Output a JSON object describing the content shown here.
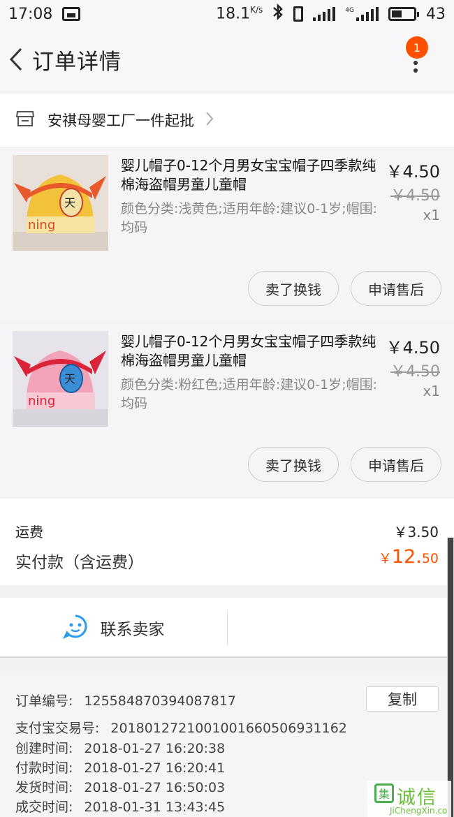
{
  "status_bar": {
    "time": "17:08",
    "speed": "18.1",
    "speed_unit": "K/s",
    "net_type": "4G",
    "battery": "43"
  },
  "nav": {
    "title": "订单详情",
    "badge_count": "1"
  },
  "shop": {
    "name": "安祺母婴工厂一件起批"
  },
  "items": [
    {
      "title": "婴儿帽子0-12个月男女宝宝帽子四季款纯棉海盗帽男童儿童帽",
      "sku": "颜色分类:浅黄色;适用年龄:建议0-1岁;帽围:均码",
      "price": "￥4.50",
      "original_price": "￥4.50",
      "quantity": "x1",
      "image_color": "yellow",
      "image_text": "ning",
      "sell_label": "卖了换钱",
      "after_sale_label": "申请售后"
    },
    {
      "title": "婴儿帽子0-12个月男女宝宝帽子四季款纯棉海盗帽男童儿童帽",
      "sku": "颜色分类:粉红色;适用年龄:建议0-1岁;帽围:均码",
      "price": "￥4.50",
      "original_price": "￥4.50",
      "quantity": "x1",
      "image_color": "pink",
      "image_text": "ning",
      "sell_label": "卖了换钱",
      "after_sale_label": "申请售后"
    }
  ],
  "summary": {
    "shipping_label": "运费",
    "shipping_value": "￥3.50",
    "paid_label": "实付款（含运费）",
    "paid_currency": "￥",
    "paid_int": "12.",
    "paid_dec": "50",
    "accent_color": "#ff5000"
  },
  "contact": {
    "label": "联系卖家",
    "icon": "chat-bubble-icon"
  },
  "order": {
    "copy_label": "复制",
    "rows": [
      {
        "label": "订单编号:",
        "value": "125584870394087817"
      },
      {
        "label": "支付宝交易号:",
        "value": "20180127210010016605069311​62"
      },
      {
        "label": "创建时间:",
        "value": "2018-01-27 16:20:38"
      },
      {
        "label": "付款时间:",
        "value": "2018-01-27 16:20:41"
      },
      {
        "label": "发货时间:",
        "value": "2018-01-27 16:50:03"
      },
      {
        "label": "成交时间:",
        "value": "2018-01-31 13:43:45"
      }
    ]
  },
  "watermark": {
    "logo_char": "集",
    "cn": "诚信",
    "en": "JiChengXin.co"
  }
}
